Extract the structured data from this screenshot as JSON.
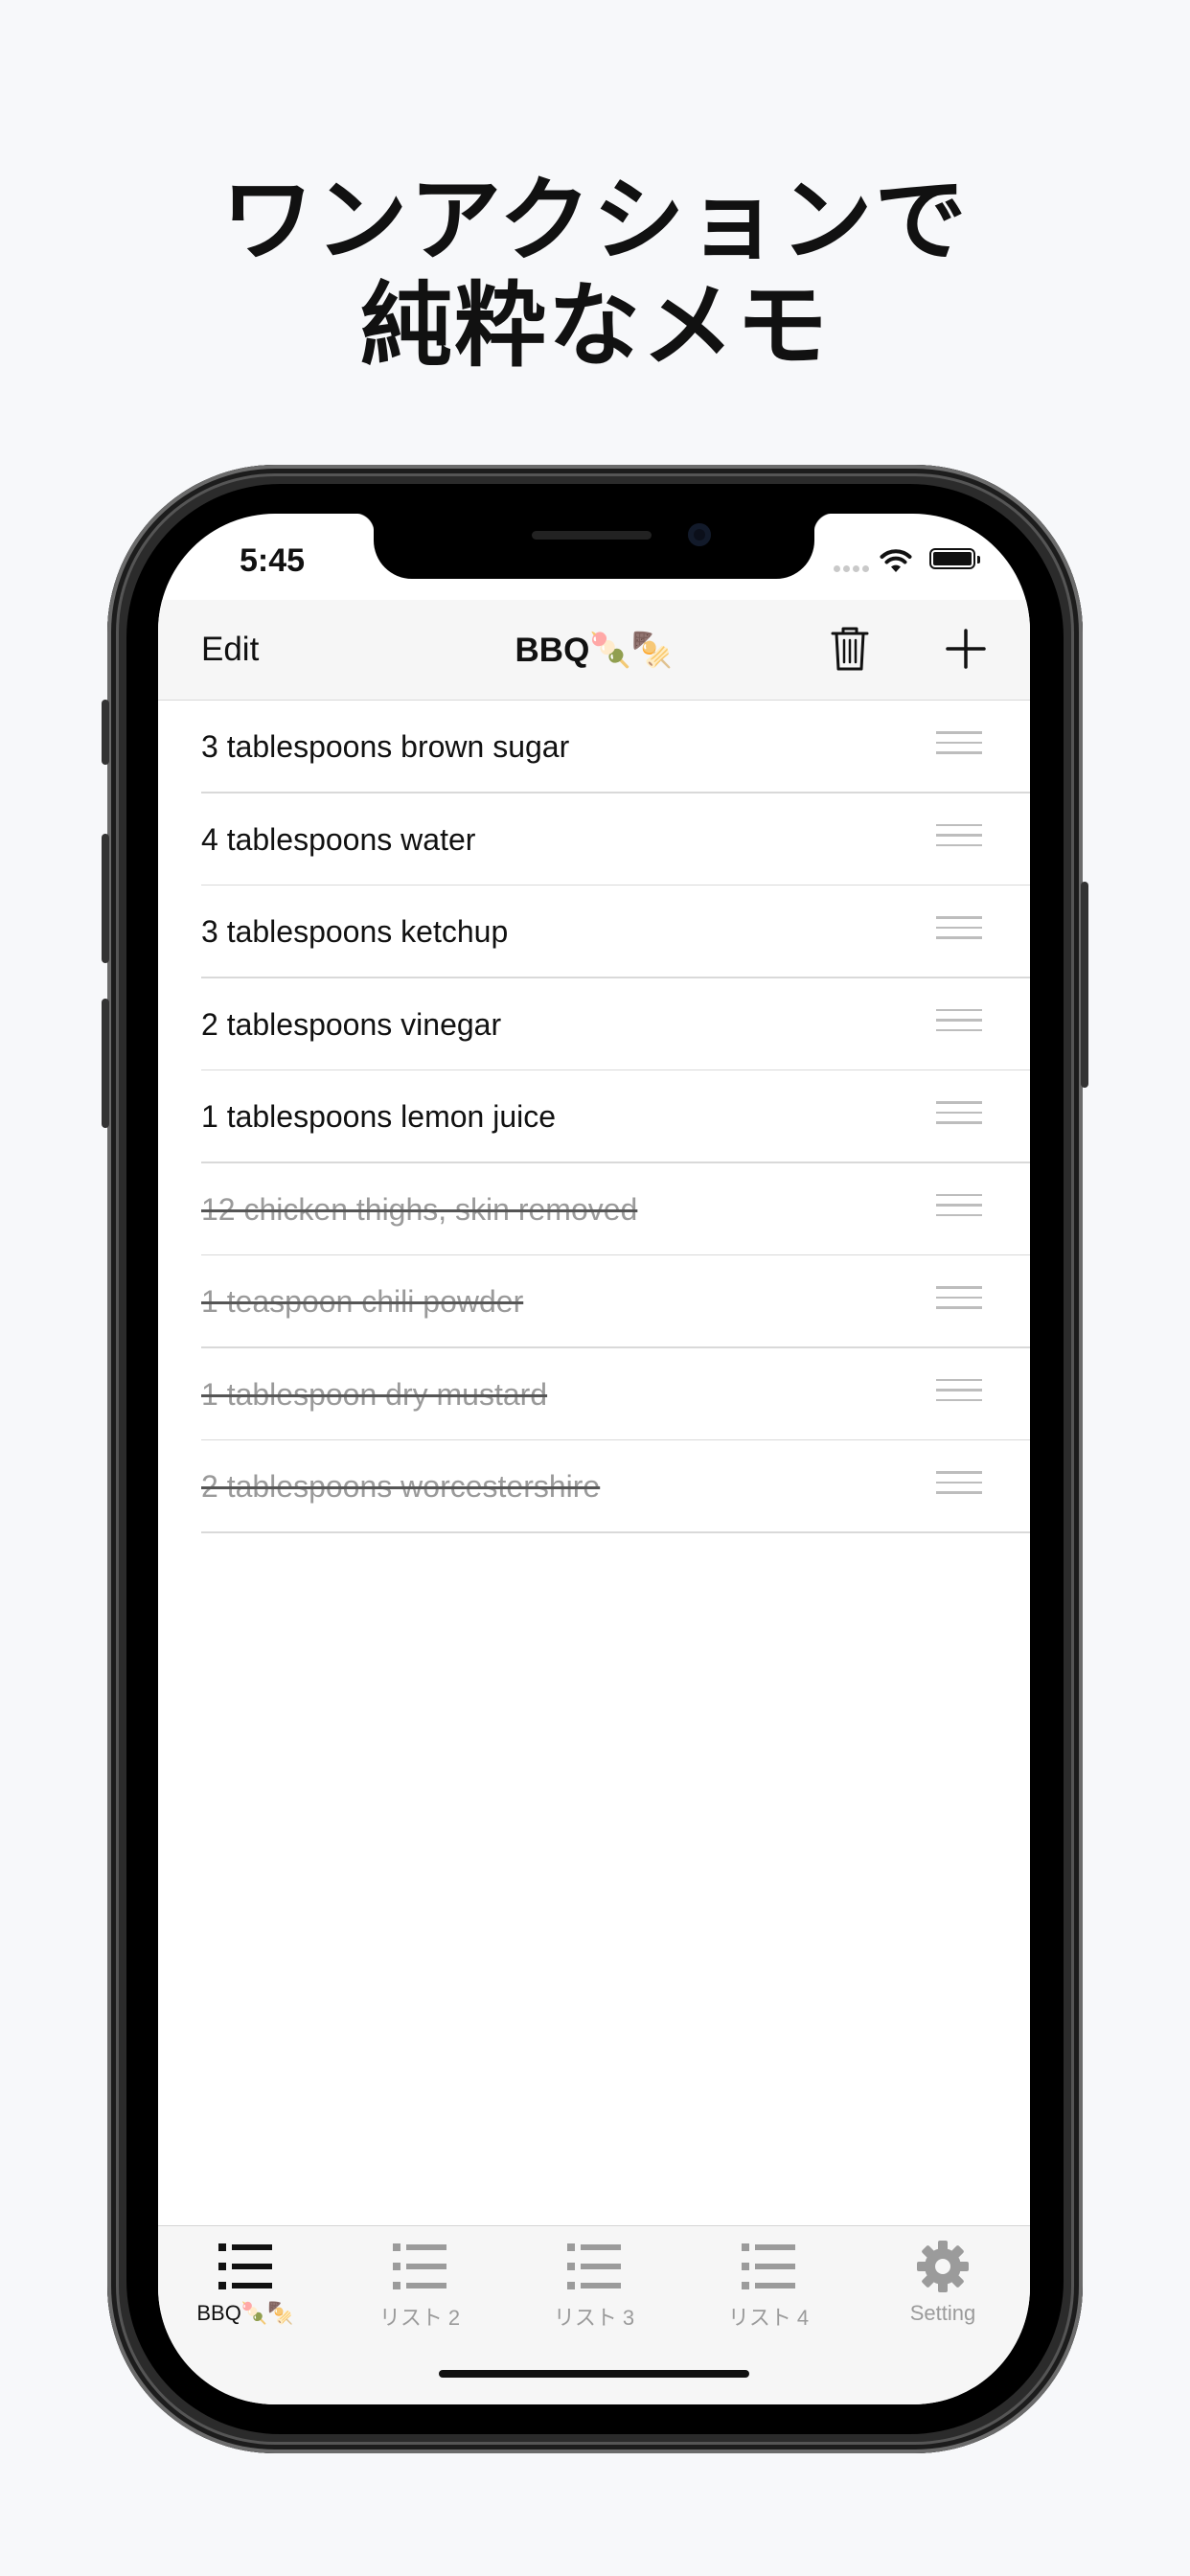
{
  "headline": {
    "line1": "ワンアクションで",
    "line2": "純粋なメモ"
  },
  "status": {
    "time": "5:45"
  },
  "navbar": {
    "edit_label": "Edit",
    "title": "BBQ🍡🍢"
  },
  "items": [
    {
      "text": "3 tablespoons brown sugar",
      "done": false
    },
    {
      "text": "4 tablespoons water",
      "done": false
    },
    {
      "text": "3 tablespoons ketchup",
      "done": false
    },
    {
      "text": "2 tablespoons vinegar",
      "done": false
    },
    {
      "text": "1 tablespoons lemon juice",
      "done": false
    },
    {
      "text": "12 chicken thighs, skin removed",
      "done": true
    },
    {
      "text": "1 teaspoon chili powder",
      "done": true
    },
    {
      "text": "1 tablespoon dry mustard",
      "done": true
    },
    {
      "text": "2 tablespoons worcestershire",
      "done": true
    }
  ],
  "tabs": [
    {
      "label": "BBQ🍡🍢",
      "icon": "list-icon",
      "active": true
    },
    {
      "label": "リスト 2",
      "icon": "list-icon",
      "active": false
    },
    {
      "label": "リスト 3",
      "icon": "list-icon",
      "active": false
    },
    {
      "label": "リスト 4",
      "icon": "list-icon",
      "active": false
    },
    {
      "label": "Setting",
      "icon": "gear-icon",
      "active": false
    }
  ],
  "colors": {
    "background": "#f7f8fa",
    "done_text": "#9a9a9a",
    "active_tab": "#111111",
    "inactive_tab": "#9b9b9b"
  }
}
